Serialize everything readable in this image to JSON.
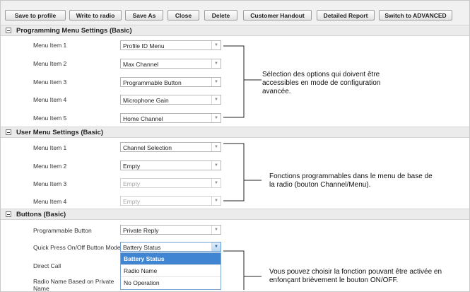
{
  "toolbar": {
    "save_to_profile": "Save to profile",
    "write_to_radio": "Write to radio",
    "save_as": "Save As",
    "close": "Close",
    "delete": "Delete",
    "customer_handout": "Customer Handout",
    "detailed_report": "Detailed Report",
    "switch_advanced": "Switch to ADVANCED"
  },
  "programming_menu": {
    "title": "Programming Menu Settings (Basic)",
    "items": [
      {
        "label": "Menu Item 1",
        "value": "Profile ID Menu"
      },
      {
        "label": "Menu Item 2",
        "value": "Max Channel"
      },
      {
        "label": "Menu Item 3",
        "value": "Programmable Button"
      },
      {
        "label": "Menu Item 4",
        "value": "Microphone Gain"
      },
      {
        "label": "Menu Item 5",
        "value": "Home Channel"
      }
    ]
  },
  "user_menu": {
    "title": "User Menu Settings (Basic)",
    "items": [
      {
        "label": "Menu Item 1",
        "value": "Channel Selection"
      },
      {
        "label": "Menu Item 2",
        "value": "Empty"
      },
      {
        "label": "Menu Item 3",
        "value": "Empty"
      },
      {
        "label": "Menu Item 4",
        "value": "Empty"
      }
    ]
  },
  "buttons": {
    "title": "Buttons (Basic)",
    "items": [
      {
        "label": "Programmable Button",
        "value": "Private Reply"
      },
      {
        "label": "Quick Press On/Off Button Mode",
        "value": "Battery Status"
      },
      {
        "label": "Direct Call"
      },
      {
        "label": "Radio Name Based on Private Name"
      }
    ],
    "dropdown_options": [
      "Battery Status",
      "Radio Name",
      "No Operation"
    ]
  },
  "callouts": {
    "programming": "Sélection des options qui doivent être accessibles en mode de configuration avancée.",
    "user_menu": "Fonctions programmables dans le menu de base de la radio (bouton Channel/Menu).",
    "buttons": "Vous pouvez choisir la fonction pouvant être activée en enfonçant brièvement le bouton ON/OFF."
  },
  "colors": {
    "section_header_bg": "#ebebeb",
    "selected_option_bg": "#3f85d2",
    "toolbar_bg": "#f1f1f1"
  },
  "icons": {
    "section_toggle": "collapse-minus-icon",
    "dropdown_arrow": "chevron-down-icon"
  }
}
